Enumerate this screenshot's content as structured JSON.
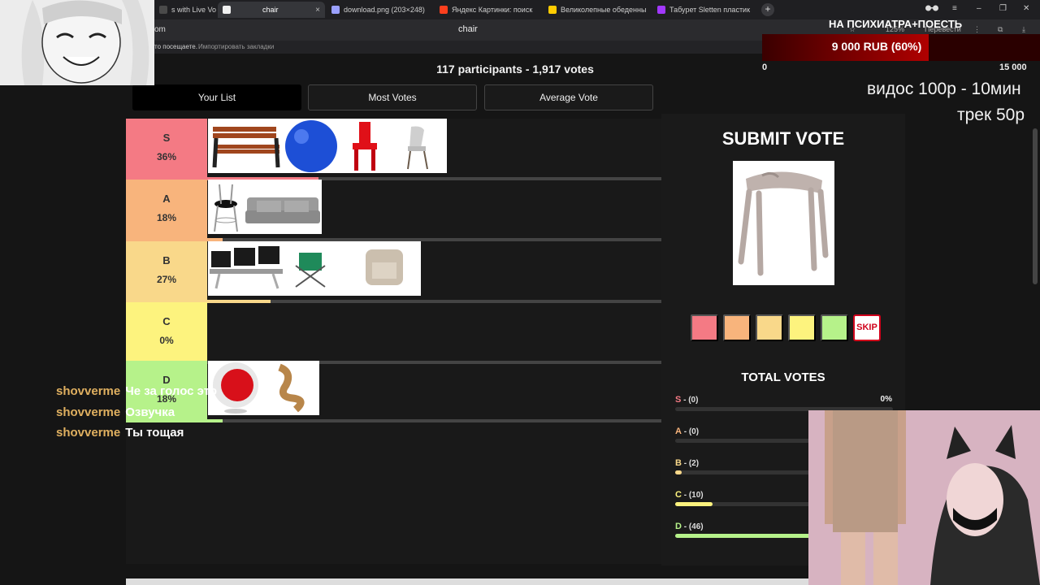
{
  "browser": {
    "tabs": [
      {
        "label": "s with Live Voting",
        "color": "#4a4a4a"
      },
      {
        "label": "chair",
        "color": "#f0f0f0"
      },
      {
        "label": "download.png (203×248)",
        "color": "#9aa0ff"
      },
      {
        "label": "Яндекс Картинки: поиск",
        "color": "#fc3f1d"
      },
      {
        "label": "Великолепные обеденны",
        "color": "#ffcc00"
      },
      {
        "label": "Табурет Sletten пластик",
        "color": "#a238ff"
      }
    ],
    "tab_close": "×",
    "new_tab": "+",
    "address_left": "om",
    "page_title": "chair",
    "zoom": "125%",
    "translate": "Перевести",
    "bookmarks": {
      "visited_hint": "то посещаете.",
      "import": "Импортировать закладки"
    }
  },
  "header": {
    "participants": "117 participants - 1,917 votes"
  },
  "list_tabs": [
    "Your List",
    "Most Votes",
    "Average Vote"
  ],
  "tiers": [
    {
      "tier": "S",
      "percent": "36%",
      "color": "#f47a84",
      "fill": 0.36,
      "items": [
        "wooden-bench",
        "blue-exercise-ball",
        "red-kids-chair",
        "gray-dining-chair"
      ]
    },
    {
      "tier": "A",
      "percent": "18%",
      "color": "#f8b47c",
      "fill": 0.18,
      "items": [
        "black-bar-stool",
        "gray-sofa"
      ]
    },
    {
      "tier": "B",
      "percent": "27%",
      "color": "#f9d88a",
      "fill": 0.27,
      "items": [
        "airport-bench",
        "camping-chair",
        "beige-armchair"
      ]
    },
    {
      "tier": "C",
      "percent": "0%",
      "color": "#fdf37e",
      "fill": 0,
      "items": []
    },
    {
      "tier": "D",
      "percent": "18%",
      "color": "#b6f28a",
      "fill": 0.18,
      "items": [
        "ball-chair",
        "wavy-wooden-chair"
      ]
    }
  ],
  "submit": {
    "title": "SUBMIT VOTE",
    "candidate": "beige-plastic-stool",
    "vote_colors": [
      "#f47a84",
      "#f8b47c",
      "#f9d88a",
      "#fdf37e",
      "#b6f28a"
    ],
    "skip_label": "SKIP"
  },
  "total_votes": {
    "title": "TOTAL VOTES",
    "rows": [
      {
        "letter": "S",
        "count": " - (0)",
        "percent": "0%",
        "color": "#f47a84",
        "fill": 0
      },
      {
        "letter": "A",
        "count": " - (0)",
        "percent": "",
        "color": "#f8b47c",
        "fill": 0
      },
      {
        "letter": "B",
        "count": " - (2)",
        "percent": "",
        "color": "#f9d88a",
        "fill": 0.03
      },
      {
        "letter": "C",
        "count": " - (10)",
        "percent": "",
        "color": "#fdf37e",
        "fill": 0.17
      },
      {
        "letter": "D",
        "count": " - (46)",
        "percent": "",
        "color": "#b6f28a",
        "fill": 0.79
      }
    ]
  },
  "overlay": {
    "donation_goal": "НА ПСИХИАТРА+ПОЕСТЬ",
    "donation_amount": "9 000 RUB (60%)",
    "donation_progress": 0.6,
    "donation_min": "0",
    "donation_max": "15 000",
    "promo_line1": "видос 100р - 10мин",
    "promo_line2": "трек 50р",
    "chat": [
      {
        "user": "shovverme",
        "message": "Че за голос это"
      },
      {
        "user": "shovverme",
        "message": "Озвучка"
      },
      {
        "user": "shovverme",
        "message": "Ты тощая"
      }
    ]
  }
}
